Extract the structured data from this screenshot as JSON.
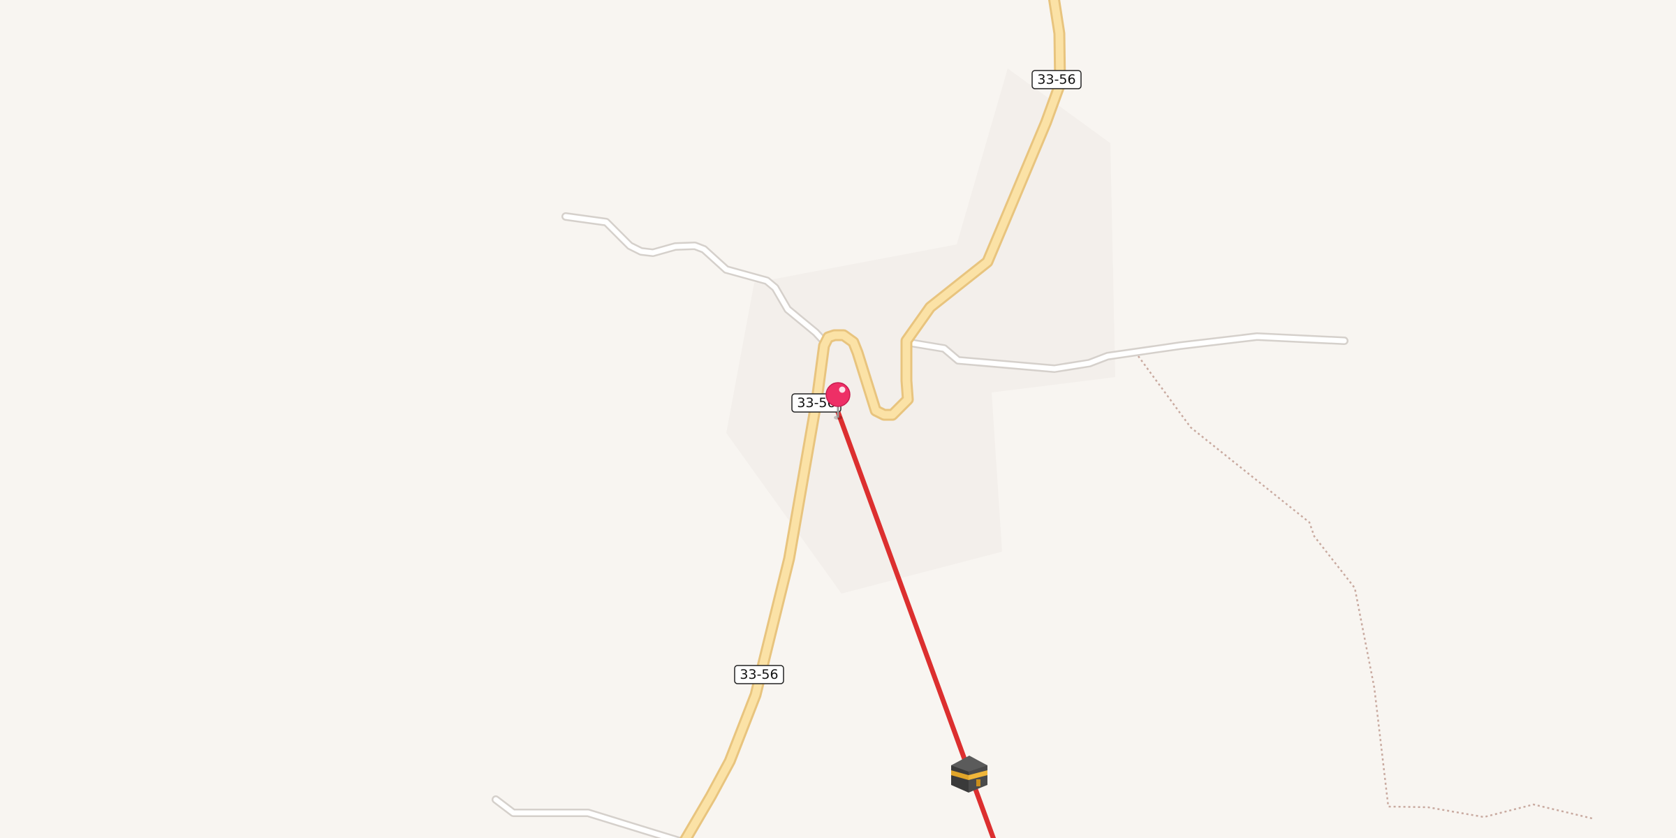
{
  "map": {
    "background_color": "#f8f5f1",
    "landuse_color": "#f3efeb",
    "primary_road": {
      "ref": "33-56",
      "fill_color": "#fbe2a6",
      "casing_color": "#e8c47e"
    },
    "minor_road": {
      "fill_color": "#ffffff",
      "casing_color": "#d5d0cb"
    },
    "track_color": "#c9aaa0",
    "qibla_line_color": "#dc2f2f",
    "location_pin": {
      "icon": "map-pin-icon",
      "color": "#ee2f66"
    },
    "kaaba_marker": {
      "icon": "kaaba-icon"
    }
  }
}
